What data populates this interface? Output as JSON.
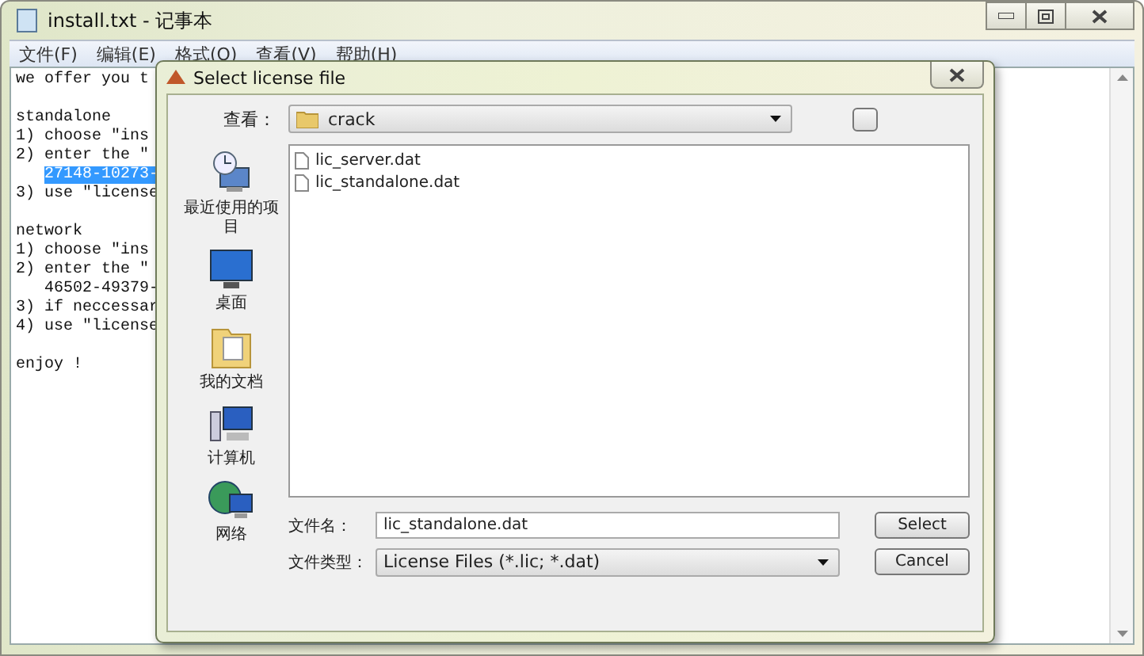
{
  "window": {
    "title": "install.txt - 记事本"
  },
  "menu": [
    "文件(F)",
    "编辑(E)",
    "格式(O)",
    "查看(V)",
    "帮助(H)"
  ],
  "document": {
    "paragraphs": [
      {
        "lines": [
          {
            "text": "we offer you t",
            "selected": false
          }
        ]
      },
      {
        "lines": [
          {
            "text": "standalone",
            "selected": false
          },
          {
            "text": "1) choose \"ins",
            "selected": false
          },
          {
            "text": "2) enter the \"",
            "selected": false,
            "children": [
              {
                "text": "27148-10273-",
                "selected": true
              }
            ]
          },
          {
            "text": "3) use \"license",
            "selected": false
          }
        ]
      },
      {
        "lines": [
          {
            "text": "network",
            "selected": false
          },
          {
            "text": "1) choose \"ins",
            "selected": false
          },
          {
            "text": "2) enter the \"",
            "selected": false,
            "children": [
              {
                "text": "46502-49379-",
                "selected": false
              }
            ]
          },
          {
            "text": "3) if neccessar",
            "selected": false
          },
          {
            "text": "4) use \"license",
            "selected": false
          }
        ]
      },
      {
        "lines": [
          {
            "text": "enjoy !",
            "selected": false
          }
        ]
      }
    ]
  },
  "dialog": {
    "title": "Select license file",
    "look_in_label": "查看：",
    "look_in_value": "crack",
    "places": [
      {
        "kind": "recent",
        "label": "最近使用的项目"
      },
      {
        "kind": "desktop",
        "label": "桌面"
      },
      {
        "kind": "documents",
        "label": "我的文档"
      },
      {
        "kind": "computer",
        "label": "计算机"
      },
      {
        "kind": "network",
        "label": "网络"
      }
    ],
    "files": [
      "lic_server.dat",
      "lic_standalone.dat"
    ],
    "file_name_label": "文件名：",
    "file_name_value": "lic_standalone.dat",
    "file_type_label": "文件类型：",
    "file_type_value": "License Files (*.lic; *.dat)",
    "buttons": [
      "Select",
      "Cancel"
    ]
  }
}
